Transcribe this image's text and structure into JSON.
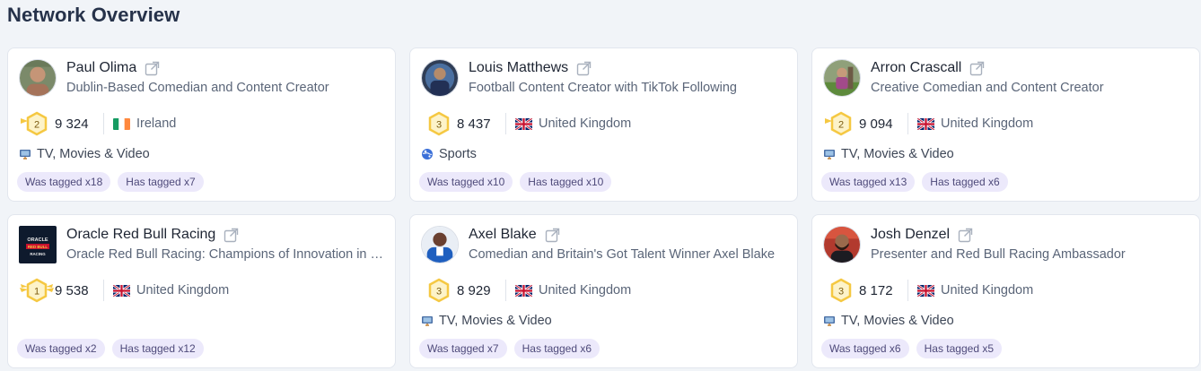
{
  "page_title": "Network Overview",
  "cards": [
    {
      "name": "Paul Olima",
      "description": "Dublin-Based Comedian and Content Creator",
      "rank": "2",
      "followers": "9 324",
      "country": "Ireland",
      "category": "TV, Movies & Video",
      "was_tagged": "Was tagged x18",
      "has_tagged": "Has tagged x7"
    },
    {
      "name": "Louis Matthews",
      "description": "Football Content Creator with TikTok Following",
      "rank": "3",
      "followers": "8 437",
      "country": "United Kingdom",
      "category": "Sports",
      "was_tagged": "Was tagged x10",
      "has_tagged": "Has tagged x10"
    },
    {
      "name": "Arron Crascall",
      "description": "Creative Comedian and Content Creator",
      "rank": "2",
      "followers": "9 094",
      "country": "United Kingdom",
      "category": "TV, Movies & Video",
      "was_tagged": "Was tagged x13",
      "has_tagged": "Has tagged x6"
    },
    {
      "name": "Oracle Red Bull Racing",
      "description": "Oracle Red Bull Racing: Champions of Innovation in Formula One",
      "rank": "1",
      "followers": "9 538",
      "country": "United Kingdom",
      "category": "",
      "was_tagged": "Was tagged x2",
      "has_tagged": "Has tagged x12",
      "avatar_logo": "ORACLE RED BULL RACING"
    },
    {
      "name": "Axel Blake",
      "description": "Comedian and Britain's Got Talent Winner Axel Blake",
      "rank": "3",
      "followers": "8 929",
      "country": "United Kingdom",
      "category": "TV, Movies & Video",
      "was_tagged": "Was tagged x7",
      "has_tagged": "Has tagged x6"
    },
    {
      "name": "Josh Denzel",
      "description": "Presenter and Red Bull Racing Ambassador",
      "rank": "3",
      "followers": "8 172",
      "country": "United Kingdom",
      "category": "TV, Movies & Video",
      "was_tagged": "Was tagged x6",
      "has_tagged": "Has tagged x5"
    }
  ],
  "colors": {
    "background": "#f1f4f8",
    "tag_bg": "#ece9fb",
    "badge_gold": "#f5c842",
    "badge_fill": "#fdf3c9"
  },
  "icons": {
    "external_link": "external-link-icon",
    "tv_category": "tv-icon",
    "sports_category": "globe-ball-icon",
    "flag_ireland": "flag-ireland-icon",
    "flag_uk": "flag-uk-icon",
    "rank_badge": "hexagon-badge-icon"
  }
}
